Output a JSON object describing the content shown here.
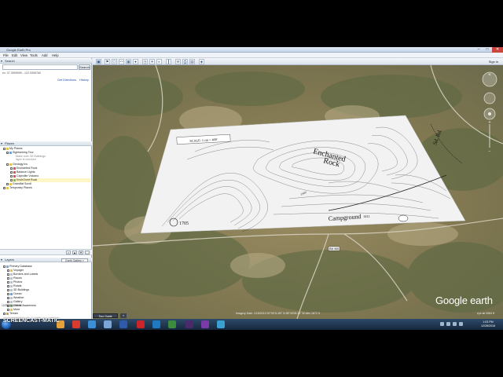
{
  "window": {
    "title": "Google Earth Pro",
    "minimize": "–",
    "maximize": "□",
    "close": "✕"
  },
  "menu": [
    "File",
    "Edit",
    "View",
    "Tools",
    "Add",
    "Help"
  ],
  "search": {
    "header": "Search",
    "placeholder": "",
    "button": "Search",
    "history": "ex: 37.3599999, -122.0006760",
    "get_directions": "Get Directions",
    "history_link": "History"
  },
  "places": {
    "header": "Places",
    "items": [
      {
        "label": "My Places",
        "level": 0,
        "sub": false
      },
      {
        "label": "Sightseeing Tour",
        "level": 1,
        "sub": false
      },
      {
        "label": "Make sure 3D Buildings",
        "level": 2,
        "sub": true
      },
      {
        "label": "layer is checked",
        "level": 2,
        "sub": true
      },
      {
        "label": "Geology Inc",
        "level": 1,
        "sub": false
      },
      {
        "label": "Enchanted Rock",
        "level": 2,
        "sub": false
      },
      {
        "label": "Balance Lights",
        "level": 2,
        "sub": false
      },
      {
        "label": "Caprolite Volcano",
        "level": 2,
        "sub": false
      },
      {
        "label": "EnchOvert Rock",
        "level": 2,
        "sub": false,
        "highlight": true
      },
      {
        "label": "Grandfat Scroll",
        "level": 1,
        "sub": false
      },
      {
        "label": "Temporary Places",
        "level": 0,
        "sub": false
      }
    ]
  },
  "layers": {
    "header": "Layers",
    "gallery": "Earth Gallery »",
    "items": [
      "Primary Database",
      "Voyager",
      "Borders and Labels",
      "Places",
      "Photos",
      "Roads",
      "3D Buildings",
      "Ocean",
      "Weather",
      "Gallery",
      "Global Awareness",
      "More",
      "Terrain"
    ]
  },
  "map": {
    "overlay_scale": "SCALE: 1 cm = 400'",
    "overlay_rock_line1": "Enchanted",
    "overlay_rock_line2": "Rock",
    "overlay_campground": "Campground",
    "overlay_elev1": "1705",
    "overlay_elev2": "1411",
    "overlay_label_road": "Sd. Rd.",
    "contour_label": "1600",
    "road_tag": "RM 965",
    "logo": "Google earth",
    "date_stamp": "12/28/2016 08:51",
    "status": "Imagery Date: 1/18/2019    30°30'11.89\" N  98°49'08.13\" W elev 1672 ft",
    "eye_alt": "eye alt 3984 ft"
  },
  "tour": {
    "guide": "Tour Guide",
    "arrow": "‹›"
  },
  "signin": "Sign in",
  "taskbar": {
    "watermark": "SCREENCAST-MATIC",
    "time": "1:03 PM",
    "date": "12/28/2016"
  }
}
